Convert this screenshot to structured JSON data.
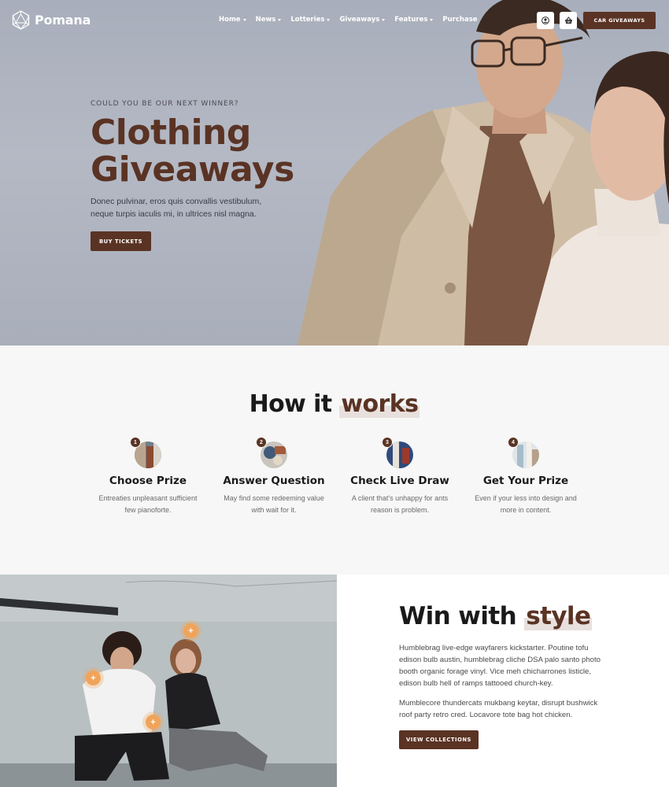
{
  "brand": {
    "name": "Pomana"
  },
  "nav": {
    "items": [
      {
        "label": "Home",
        "dropdown": true
      },
      {
        "label": "News",
        "dropdown": true
      },
      {
        "label": "Lotteries",
        "dropdown": true
      },
      {
        "label": "Giveaways",
        "dropdown": true
      },
      {
        "label": "Features",
        "dropdown": true
      },
      {
        "label": "Purchase",
        "dropdown": false
      }
    ],
    "account_icon": "user-icon",
    "cart_icon": "basket-icon",
    "cta_label": "CAR GIVEAWAYS"
  },
  "hero": {
    "eyebrow": "COULD YOU BE OUR NEXT WINNER?",
    "title": "Clothing Giveaways",
    "text": "Donec pulvinar, eros quis convallis vestibulum, neque turpis iaculis mi, in ultrices nisl magna.",
    "button_label": "BUY TICKETS"
  },
  "how": {
    "title_plain": "How it",
    "title_highlight": "works",
    "steps": [
      {
        "number": "1",
        "title": "Choose Prize",
        "text": "Entreaties unpleasant sufficient few pianoforte."
      },
      {
        "number": "2",
        "title": "Answer Question",
        "text": "May find some redeeming value with wait for it."
      },
      {
        "number": "3",
        "title": "Check Live Draw",
        "text": "A client that's unhappy for ants reason is problem."
      },
      {
        "number": "4",
        "title": "Get Your Prize",
        "text": "Even if your less into design and more in content."
      }
    ]
  },
  "win": {
    "title_plain": "Win with",
    "title_highlight": "style",
    "paragraphs": [
      "Humblebrag live-edge wayfarers kickstarter. Poutine tofu edison bulb austin, humblebrag cliche DSA palo santo photo booth organic forage vinyl. Vice meh chicharrones listicle, edison bulb hell of ramps tattooed church-key.",
      "Mumblecore thundercats mukbang keytar, disrupt bushwick roof party retro cred. Locavore tote bag hot chicken."
    ],
    "button_label": "VIEW COLLECTIONS",
    "hotspot_symbol": "+"
  },
  "colors": {
    "accent": "#5a3324",
    "hotspot": "#f0a45a",
    "section_bg": "#f7f7f7"
  }
}
